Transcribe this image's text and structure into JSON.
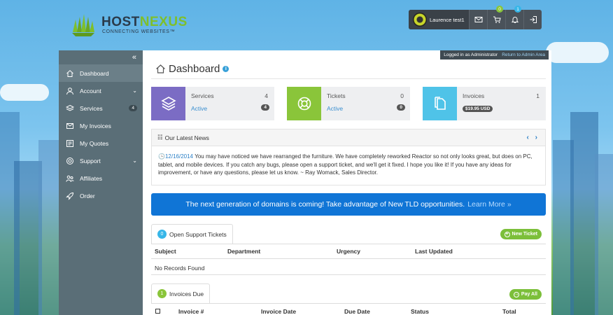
{
  "brand": {
    "name_main": "HOST",
    "name_accent": "NEXUS",
    "tagline": "CONNECTING WEBSITES™"
  },
  "topbar": {
    "username": "Laurence test1",
    "cart_count": "0",
    "notifications_count": "1"
  },
  "sidebar": {
    "collapse_glyph": "«",
    "items": [
      {
        "label": "Dashboard",
        "icon": "home-icon",
        "active": true
      },
      {
        "label": "Account",
        "icon": "user-icon",
        "chevron": "⌄"
      },
      {
        "label": "Services",
        "icon": "layers-icon",
        "count": "4"
      },
      {
        "label": "My Invoices",
        "icon": "envelope-icon"
      },
      {
        "label": "My Quotes",
        "icon": "quote-icon"
      },
      {
        "label": "Support",
        "icon": "support-icon",
        "chevron": "⌄"
      },
      {
        "label": "Affiliates",
        "icon": "affiliates-icon"
      },
      {
        "label": "Order",
        "icon": "rocket-icon"
      }
    ]
  },
  "admin_bar": {
    "text": "Logged in as Administrator",
    "link": "Return to Admin Area"
  },
  "page": {
    "title": "Dashboard",
    "info_glyph": "i"
  },
  "tiles": [
    {
      "label": "Services",
      "count": "4",
      "sub": "Active",
      "pill": "4",
      "color": "#7b6cc4",
      "icon": "layers-icon"
    },
    {
      "label": "Tickets",
      "count": "0",
      "sub": "Active",
      "pill": "0",
      "color": "#8ac53a",
      "icon": "lifebuoy-icon"
    },
    {
      "label": "Invoices",
      "count": "1",
      "pill": "$19.95 USD",
      "color": "#4fc3e8",
      "icon": "documents-icon"
    }
  ],
  "news": {
    "heading": "Our Latest News",
    "arrows": "‹ ›",
    "date": "12/16/2014",
    "body": "You may have noticed we have rearranged the furniture.  We have completely reworked Reactor so not only looks great, but does on PC, tablet, and mobile devices.  If you catch any bugs,  please open a support ticket, and we'll get it fixed.  I hope you like it!  If you have any ideas for improvement, or have any questions, please let us know.  ~ Ray Womack, Sales Director."
  },
  "promo": {
    "text": "The next generation of domains is coming! Take advantage of New TLD opportunities.",
    "link": "Learn More »"
  },
  "tickets": {
    "count": "0",
    "tab_label": "Open Support Tickets",
    "button": "New Ticket",
    "columns": [
      "Subject",
      "Department",
      "Urgency",
      "Last Updated"
    ],
    "empty": "No Records Found"
  },
  "invoices": {
    "count": "1",
    "tab_label": "Invoices Due",
    "button": "Pay All",
    "columns": [
      "Invoice #",
      "Invoice Date",
      "Due Date",
      "Status",
      "Total"
    ]
  }
}
